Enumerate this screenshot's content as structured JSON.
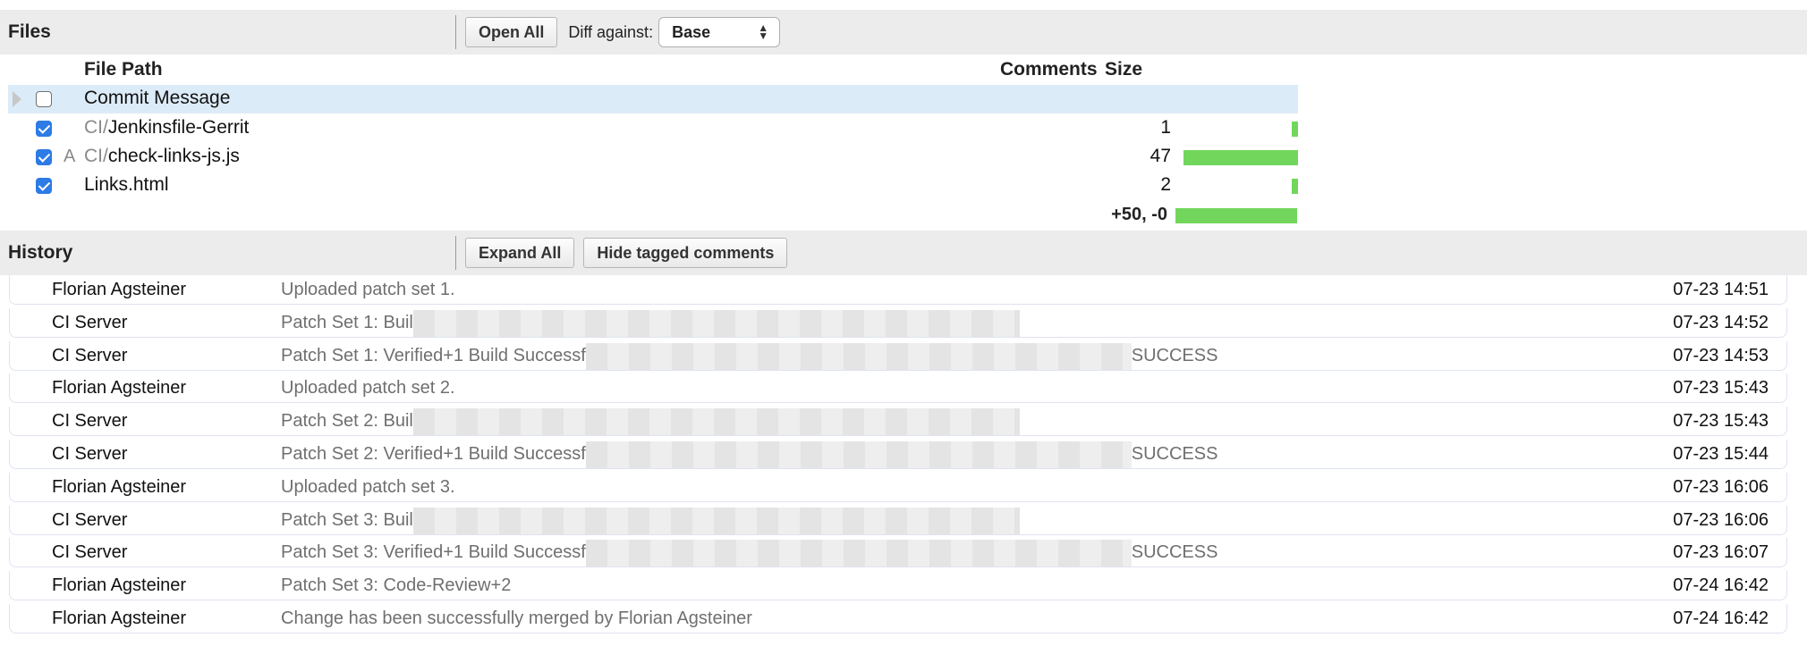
{
  "files": {
    "title": "Files",
    "open_all": "Open All",
    "diff_label": "Diff against:",
    "diff_value": "Base",
    "headers": {
      "path": "File Path",
      "comments": "Comments",
      "size": "Size"
    },
    "rows": [
      {
        "dir": "",
        "name": "Commit Message",
        "status": "",
        "comments": "",
        "size_fraction": 0,
        "checked": false,
        "selected": true
      },
      {
        "dir": "CI/",
        "name": "Jenkinsfile-Gerrit",
        "status": "",
        "comments": "1",
        "size_fraction": 0.05,
        "checked": true,
        "selected": false
      },
      {
        "dir": "CI/",
        "name": "check-links-js.js",
        "status": "A",
        "comments": "47",
        "size_fraction": 0.94,
        "checked": true,
        "selected": false
      },
      {
        "dir": "",
        "name": "Links.html",
        "status": "",
        "comments": "2",
        "size_fraction": 0.05,
        "checked": true,
        "selected": false
      }
    ],
    "total": "+50, -0",
    "total_fraction": 1.0
  },
  "history": {
    "title": "History",
    "expand_all": "Expand All",
    "hide_tagged": "Hide tagged comments",
    "rows": [
      {
        "author": "Florian Agsteiner",
        "message": "Uploaded patch set 1.",
        "redacted": false,
        "suffix": "",
        "date": "07-23 14:51"
      },
      {
        "author": "CI Server",
        "message": "Patch Set 1: Buil",
        "redacted": true,
        "redact_size": "short",
        "suffix": "",
        "date": "07-23 14:52"
      },
      {
        "author": "CI Server",
        "message": "Patch Set 1: Verified+1 Build Successf",
        "redacted": true,
        "redact_size": "long",
        "suffix": "SUCCESS",
        "date": "07-23 14:53"
      },
      {
        "author": "Florian Agsteiner",
        "message": "Uploaded patch set 2.",
        "redacted": false,
        "suffix": "",
        "date": "07-23 15:43"
      },
      {
        "author": "CI Server",
        "message": "Patch Set 2: Buil",
        "redacted": true,
        "redact_size": "short",
        "suffix": "",
        "date": "07-23 15:43"
      },
      {
        "author": "CI Server",
        "message": "Patch Set 2: Verified+1 Build Successf",
        "redacted": true,
        "redact_size": "long",
        "suffix": "SUCCESS",
        "date": "07-23 15:44"
      },
      {
        "author": "Florian Agsteiner",
        "message": "Uploaded patch set 3.",
        "redacted": false,
        "suffix": "",
        "date": "07-23 16:06"
      },
      {
        "author": "CI Server",
        "message": "Patch Set 3: Buil",
        "redacted": true,
        "redact_size": "short",
        "suffix": "",
        "date": "07-23 16:06"
      },
      {
        "author": "CI Server",
        "message": "Patch Set 3: Verified+1 Build Successf",
        "redacted": true,
        "redact_size": "long",
        "suffix": "SUCCESS",
        "date": "07-23 16:07"
      },
      {
        "author": "Florian Agsteiner",
        "message": "Patch Set 3: Code-Review+2",
        "redacted": false,
        "suffix": "",
        "date": "07-24 16:42"
      },
      {
        "author": "Florian Agsteiner",
        "message": "Change has been successfully merged by Florian Agsteiner",
        "redacted": false,
        "suffix": "",
        "date": "07-24 16:42"
      }
    ]
  }
}
